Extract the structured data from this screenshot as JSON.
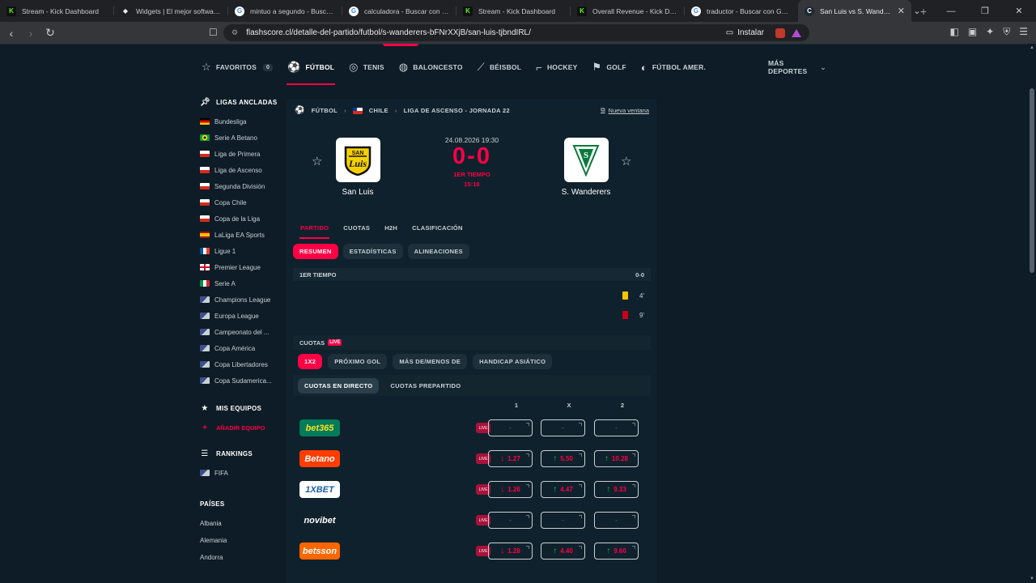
{
  "browser": {
    "tabs": [
      {
        "title": "Stream - Kick Dashboard",
        "icon": "kick"
      },
      {
        "title": "Widgets | El mejor software pa",
        "icon": "widget"
      },
      {
        "title": "mintuo a segundo - Buscar co",
        "icon": "google"
      },
      {
        "title": "calculadora - Buscar con Goo",
        "icon": "google"
      },
      {
        "title": "Stream - Kick Dashboard",
        "icon": "kick"
      },
      {
        "title": "Overall Revenue - Kick Dashb",
        "icon": "kick"
      },
      {
        "title": "traductor - Buscar con Google",
        "icon": "google"
      },
      {
        "title": "San Luis vs S. Wanderers",
        "icon": "flashscore",
        "active": true
      }
    ],
    "url": "flashscore.cl/detalle-del-partido/futbol/s-wanderers-bFNrXXjB/san-luis-tjbndIRL/",
    "install_label": "Instalar"
  },
  "sports_nav": {
    "favorites_label": "FAVORITOS",
    "favorites_count": "0",
    "items": [
      "FÚTBOL",
      "TENIS",
      "BALONCESTO",
      "BÉISBOL",
      "HOCKEY",
      "GOLF",
      "FÚTBOL AMER."
    ],
    "more_label": "MÁS DEPORTES"
  },
  "sidebar": {
    "pinned_title": "LIGAS ANCLADAS",
    "leagues": [
      {
        "name": "Bundesliga",
        "flag": "de"
      },
      {
        "name": "Serie A Betano",
        "flag": "br"
      },
      {
        "name": "Liga de Primera",
        "flag": "cl"
      },
      {
        "name": "Liga de Ascenso",
        "flag": "cl"
      },
      {
        "name": "Segunda División",
        "flag": "cl"
      },
      {
        "name": "Copa Chile",
        "flag": "cl"
      },
      {
        "name": "Copa de la Liga",
        "flag": "cl"
      },
      {
        "name": "LaLiga EA Sports",
        "flag": "es"
      },
      {
        "name": "Ligue 1",
        "flag": "fr"
      },
      {
        "name": "Premier League",
        "flag": "en"
      },
      {
        "name": "Serie A",
        "flag": "it"
      },
      {
        "name": "Champions League",
        "flag": "eu"
      },
      {
        "name": "Europa League",
        "flag": "eu"
      },
      {
        "name": "Campeonato del ...",
        "flag": "eu"
      },
      {
        "name": "Copa América",
        "flag": "eu"
      },
      {
        "name": "Copa Libertadores",
        "flag": "eu"
      },
      {
        "name": "Copa Sudamerica...",
        "flag": "eu"
      }
    ],
    "my_teams_title": "MIS EQUIPOS",
    "add_team_label": "AÑADIR EQUIPO",
    "rankings_title": "RANKINGS",
    "rankings": [
      "FIFA"
    ],
    "countries_title": "PAÍSES",
    "countries": [
      "Albania",
      "Alemania",
      "Andorra"
    ]
  },
  "match": {
    "breadcrumb": {
      "sport": "FÚTBOL",
      "country": "CHILE",
      "league": "LIGA DE ASCENSO - JORNADA 22"
    },
    "new_window_label": "Nueva ventana",
    "home": {
      "name": "San Luis"
    },
    "away": {
      "name": "S. Wanderers"
    },
    "datetime": "24.08.2026 19:30",
    "score": "0-0",
    "period": "1ER TIEMPO",
    "clock": "15:18",
    "tabs": [
      "PARTIDO",
      "CUOTAS",
      "H2H",
      "CLASIFICACIÓN"
    ],
    "subtabs": [
      "RESUMEN",
      "ESTADÍSTICAS",
      "ALINEACIONES"
    ],
    "period_row": {
      "label": "1ER TIEMPO",
      "score": "0-0"
    },
    "events": [
      {
        "minute": "4'",
        "card": "yellow"
      },
      {
        "minute": "9'",
        "card": "red"
      }
    ]
  },
  "odds": {
    "title": "CUOTAS",
    "live_badge": "LIVE",
    "markets": [
      "1X2",
      "PRÓXIMO GOL",
      "MÁS DE/MENOS DE",
      "HANDICAP ASIÁTICO"
    ],
    "modes": [
      "CUOTAS EN DIRECTO",
      "CUOTAS PREPARTIDO"
    ],
    "columns": [
      "1",
      "X",
      "2"
    ],
    "live_tag": "LIVE",
    "bookmakers": [
      {
        "name": "bet365",
        "odds": [
          "-",
          "-",
          "-"
        ],
        "trend": [
          "",
          "",
          ""
        ]
      },
      {
        "name": "Betano",
        "odds": [
          "1.27",
          "5.50",
          "10.28"
        ],
        "trend": [
          "down",
          "up",
          "up"
        ]
      },
      {
        "name": "1XBET",
        "odds": [
          "1.26",
          "4.47",
          "9.33"
        ],
        "trend": [
          "down",
          "up",
          "up"
        ]
      },
      {
        "name": "novibet",
        "odds": [
          "-",
          "-",
          "-"
        ],
        "trend": [
          "",
          "",
          ""
        ]
      },
      {
        "name": "betsson",
        "odds": [
          "1.28",
          "4.40",
          "9.60"
        ],
        "trend": [
          "down",
          "up",
          "up"
        ]
      }
    ]
  }
}
